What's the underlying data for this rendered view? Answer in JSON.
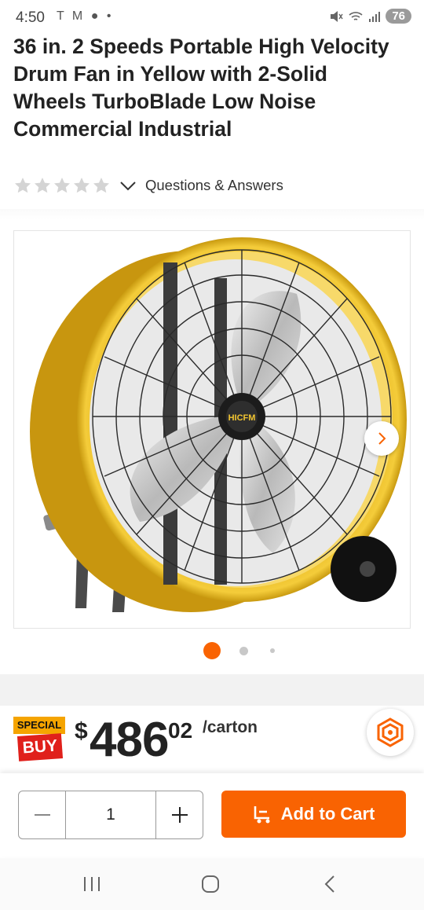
{
  "status": {
    "time": "4:50",
    "left_icons": "T M ● •",
    "battery": "76"
  },
  "product": {
    "title": "36 in. 2 Speeds Portable High Velocity Drum Fan in Yellow with 2-Solid Wheels TurboBlade Low Noise Commercial Industrial",
    "rating_stars": 5,
    "questions_label": "Questions & Answers",
    "brand_label": "HICFM"
  },
  "gallery": {
    "total": 3,
    "active_index": 0
  },
  "price": {
    "badge_top": "SPECIAL",
    "badge_bottom": "BUY",
    "currency": "$",
    "whole": "486",
    "cents": "02",
    "unit": "/carton"
  },
  "cart": {
    "quantity": "1",
    "add_label": "Add to Cart"
  },
  "colors": {
    "accent": "#f96302",
    "fan_yellow": "#f2c531",
    "badge_red": "#e0201b",
    "badge_yellow": "#f5a400"
  },
  "icons": [
    "star-icon",
    "chevron-down-icon",
    "chevron-right-icon",
    "minus-icon",
    "plus-icon",
    "cart-icon",
    "home-depot-logo",
    "recents-icon",
    "home-icon",
    "back-icon"
  ]
}
